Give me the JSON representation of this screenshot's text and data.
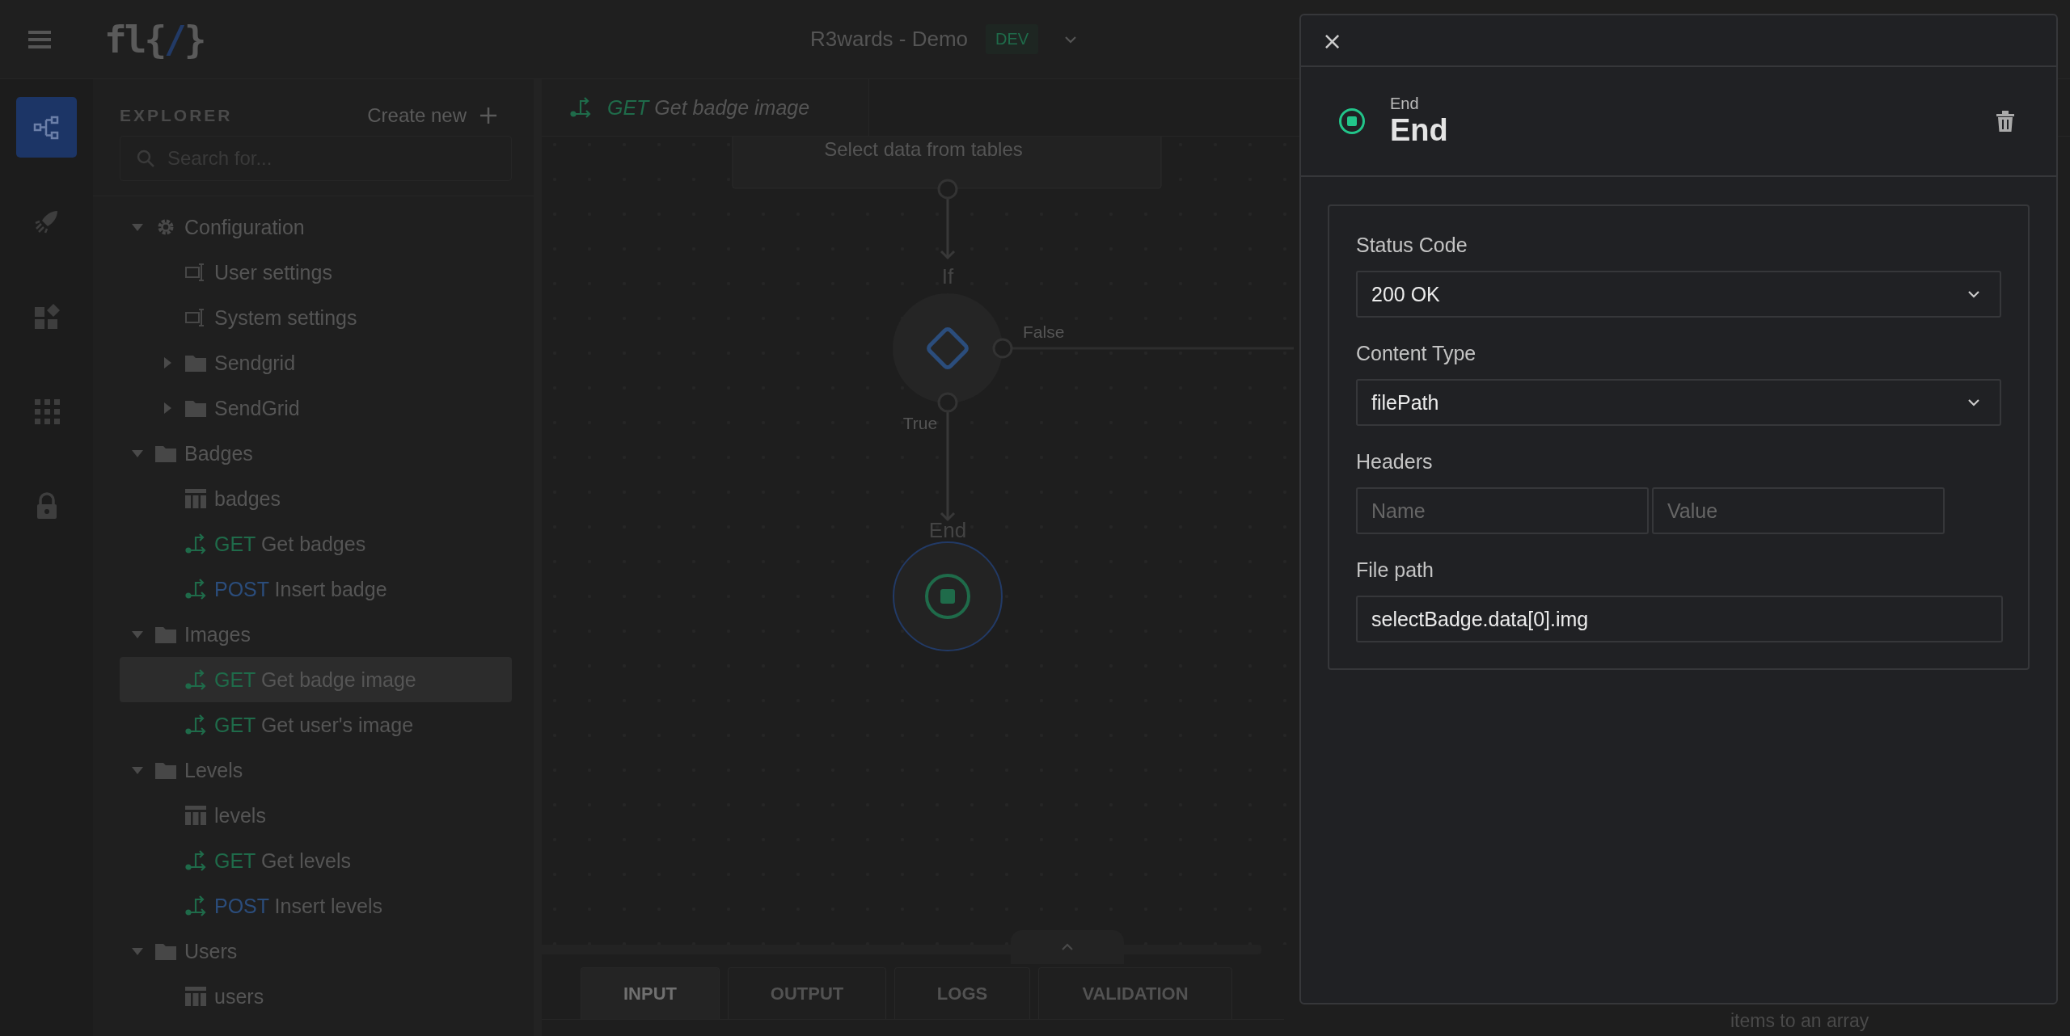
{
  "topbar": {
    "logo": {
      "before": "fl{",
      "accent": "/",
      "after": "}"
    },
    "project": "R3wards - Demo",
    "environment": "DEV"
  },
  "rail": [
    {
      "kind": "flow",
      "selected": true
    },
    {
      "kind": "rocket",
      "selected": false
    },
    {
      "kind": "widgets",
      "selected": false
    },
    {
      "kind": "apps",
      "selected": false
    },
    {
      "kind": "lock",
      "selected": false
    }
  ],
  "explorer": {
    "title": "EXPLORER",
    "create_label": "Create new",
    "search": {
      "placeholder": "Search for..."
    },
    "tree": [
      {
        "kind": "settings",
        "label": "Configuration",
        "expanded": true,
        "selected": false,
        "children": [
          {
            "kind": "config",
            "label": "User settings",
            "selected": false
          },
          {
            "kind": "config",
            "label": "System settings",
            "selected": false
          },
          {
            "kind": "folder",
            "label": "Sendgrid",
            "expanded": false,
            "selected": false
          },
          {
            "kind": "folder",
            "label": "SendGrid",
            "expanded": false,
            "selected": false
          }
        ]
      },
      {
        "kind": "folder",
        "label": "Badges",
        "expanded": true,
        "selected": false,
        "children": [
          {
            "kind": "table",
            "label": "badges",
            "selected": false
          },
          {
            "kind": "endpoint",
            "method": "GET",
            "color": "#1f6b4a",
            "label": "Get badges",
            "selected": false
          },
          {
            "kind": "endpoint",
            "method": "POST",
            "color": "#2b4d7c",
            "label": "Insert badge",
            "selected": false
          }
        ]
      },
      {
        "kind": "folder",
        "label": "Images",
        "expanded": true,
        "selected": false,
        "children": [
          {
            "kind": "endpoint",
            "method": "GET",
            "color": "#1f6b4a",
            "label": "Get badge image",
            "selected": true
          },
          {
            "kind": "endpoint",
            "method": "GET",
            "color": "#1f6b4a",
            "label": "Get user's image",
            "selected": false
          }
        ]
      },
      {
        "kind": "folder",
        "label": "Levels",
        "expanded": true,
        "selected": false,
        "children": [
          {
            "kind": "table",
            "label": "levels",
            "selected": false
          },
          {
            "kind": "endpoint",
            "method": "GET",
            "color": "#1f6b4a",
            "label": "Get levels",
            "selected": false
          },
          {
            "kind": "endpoint",
            "method": "POST",
            "color": "#2b4d7c",
            "label": "Insert levels",
            "selected": false
          }
        ]
      },
      {
        "kind": "folder",
        "label": "Users",
        "expanded": true,
        "selected": false,
        "children": [
          {
            "kind": "table",
            "label": "users",
            "selected": false
          }
        ]
      }
    ]
  },
  "editor_tab": {
    "method": "GET",
    "color": "#1f6b4a",
    "label": "Get badge image"
  },
  "flow": {
    "select_node": "Select data from tables",
    "if_node": "If",
    "false_label": "False",
    "true_label": "True",
    "end_node": "End"
  },
  "bottom_tabs": [
    {
      "label": "INPUT",
      "selected": true
    },
    {
      "label": "OUTPUT",
      "selected": false
    },
    {
      "label": "LOGS",
      "selected": false
    },
    {
      "label": "VALIDATION",
      "selected": false
    }
  ],
  "background_hint": "items to an array",
  "drawer": {
    "close": "×",
    "node_type": "End",
    "title": "End",
    "status_code": {
      "label": "Status Code",
      "value": "200 OK"
    },
    "content_type": {
      "label": "Content Type",
      "value": "filePath"
    },
    "headers": {
      "label": "Headers",
      "name_placeholder": "Name",
      "value_placeholder": "Value"
    },
    "file_path": {
      "label": "File path",
      "value": "selectBadge.data[0].img"
    }
  }
}
